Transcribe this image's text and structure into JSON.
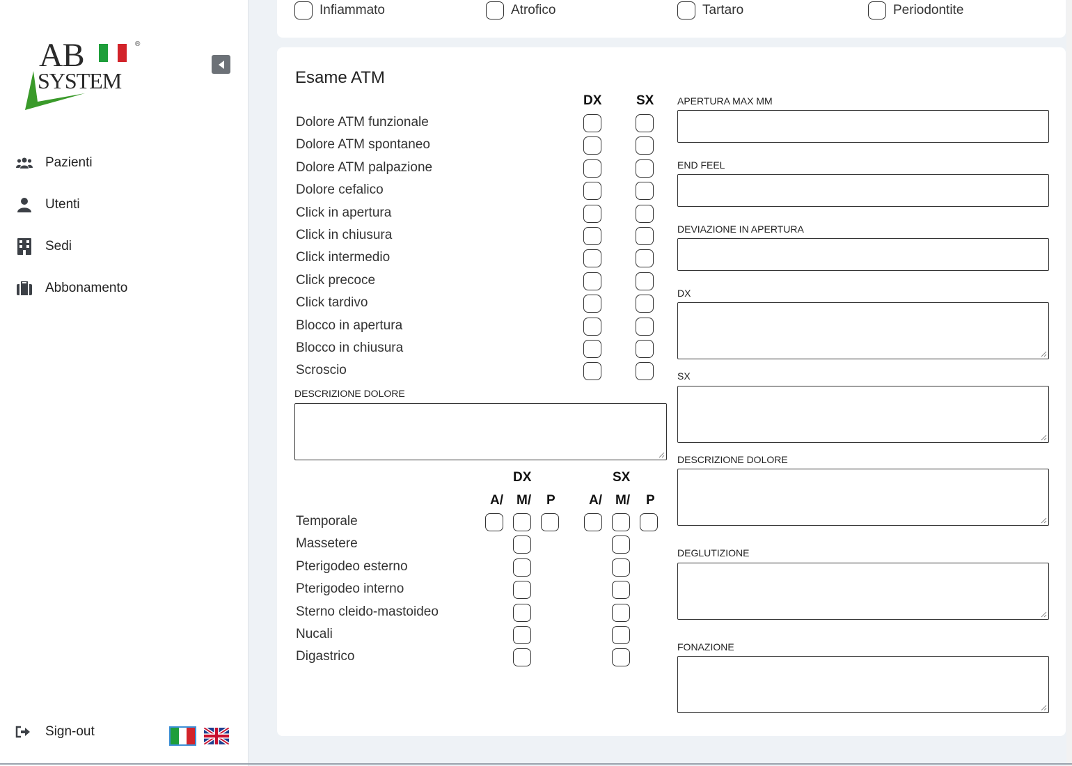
{
  "brand": {
    "logo_ab": "AB",
    "logo_system": "SYSTEM",
    "logo_reg": "®",
    "flag_colors": [
      "#1e9e3a",
      "#ffffff",
      "#d2232a"
    ],
    "swoosh_color": "#3a9a2a"
  },
  "sidebar": {
    "items": [
      {
        "label": "Pazienti",
        "icon": "users-icon"
      },
      {
        "label": "Utenti",
        "icon": "user-icon"
      },
      {
        "label": "Sedi",
        "icon": "building-icon"
      },
      {
        "label": "Abbonamento",
        "icon": "briefcase-icon"
      }
    ],
    "signout": "Sign-out"
  },
  "top_row": [
    "Infiammato",
    "Atrofico",
    "Tartaro",
    "Periodontite"
  ],
  "atm": {
    "title": "Esame ATM",
    "dx": "DX",
    "sx": "SX",
    "rows": [
      "Dolore ATM funzionale",
      "Dolore ATM spontaneo",
      "Dolore ATM palpazione",
      "Dolore cefalico",
      "Click in apertura",
      "Click in chiusura",
      "Click intermedio",
      "Click precoce",
      "Click tardivo",
      "Blocco in apertura",
      "Blocco in chiusura",
      "Scroscio"
    ],
    "descrizione_label": "DESCRIZIONE DOLORE"
  },
  "muscles": {
    "dx": "DX",
    "sx": "SX",
    "sub": [
      "A/",
      "M/",
      "P"
    ],
    "rows": [
      "Temporale",
      "Massetere",
      "Pterigodeo esterno",
      "Pterigodeo interno",
      "Sterno cleido-mastoideo",
      "Nucali",
      "Digastrico"
    ]
  },
  "right_fields": {
    "apertura": "APERTURA MAX MM",
    "end_feel": "END FEEL",
    "deviazione": "DEVIAZIONE IN APERTURA",
    "dx": "DX",
    "sx": "SX",
    "descrizione": "DESCRIZIONE DOLORE",
    "deglutizione": "DEGLUTIZIONE",
    "fonazione": "FONAZIONE"
  }
}
